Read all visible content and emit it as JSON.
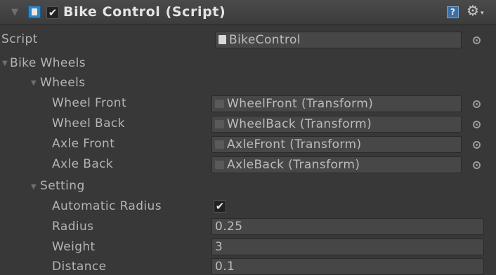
{
  "component": {
    "title": "Bike Control (Script)",
    "enabled": true,
    "icons": {
      "foldout": "triangle-down-icon",
      "script": "cs-script-icon",
      "help": "help-book-icon",
      "settings": "gear-icon"
    },
    "help_glyph": "?",
    "gear_glyph": "⚙",
    "caret_glyph": "▾",
    "check_glyph": "✔",
    "arrow_glyph": "▼"
  },
  "script_row": {
    "label": "Script",
    "value": "BikeControl"
  },
  "groups": {
    "bike_wheels": "Bike Wheels",
    "wheels": "Wheels",
    "setting": "Setting"
  },
  "wheels": [
    {
      "label": "Wheel Front",
      "value": "WheelFront (Transform)"
    },
    {
      "label": "Wheel Back",
      "value": "WheelBack (Transform)"
    },
    {
      "label": "Axle Front",
      "value": "AxleFront (Transform)"
    },
    {
      "label": "Axle Back",
      "value": "AxleBack (Transform)"
    }
  ],
  "setting": {
    "automatic_radius": {
      "label": "Automatic Radius",
      "checked": true
    },
    "radius": {
      "label": "Radius",
      "value": "0.25"
    },
    "weight": {
      "label": "Weight",
      "value": "3"
    },
    "distance": {
      "label": "Distance",
      "value": "0.1"
    }
  },
  "colors": {
    "panel_bg": "#383838",
    "field_bg": "#474747",
    "text": "#b4b4b4",
    "title_text": "#e4e4e4",
    "script_icon": "#2f86c7"
  }
}
